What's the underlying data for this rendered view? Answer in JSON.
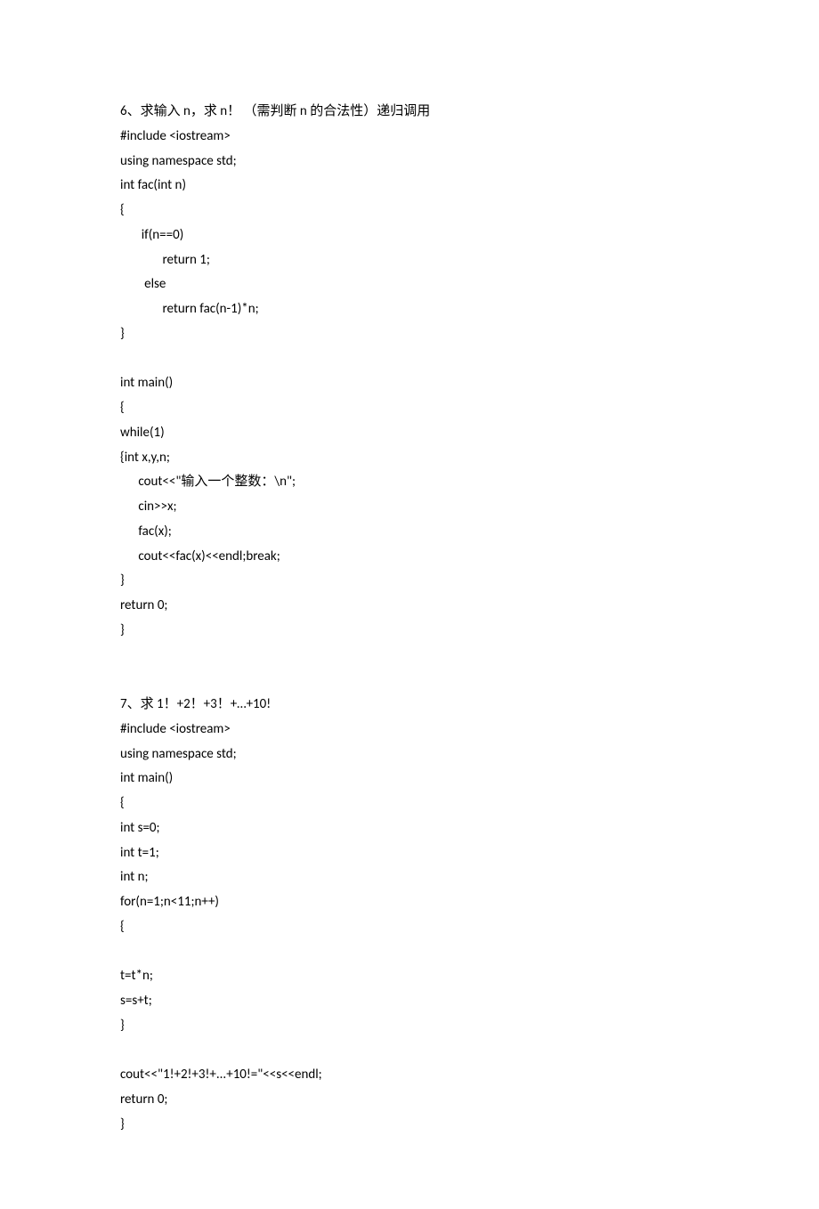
{
  "problem6": {
    "title": "6、求输入 n，求 n！ （需判断 n 的合法性）递归调用",
    "code": [
      "#include <iostream>",
      "using namespace std;",
      "int fac(int n)",
      "{",
      "       if(n==0)",
      "              return 1;",
      "        else",
      "              return fac(n-1)*n;",
      "}",
      "",
      "int main()",
      "{",
      "while(1)",
      "{int x,y,n;",
      "      cout<<\"输入一个整数：\\n\";",
      "      cin>>x;",
      "      fac(x);",
      "      cout<<fac(x)<<endl;break;",
      "}",
      "return 0;",
      "}"
    ]
  },
  "problem7": {
    "title": "7、求 1！+2！+3！+…+10!",
    "code": [
      "#include <iostream>",
      "using namespace std;",
      "int main()",
      "{",
      "int s=0;",
      "int t=1;",
      "int n;",
      "for(n=1;n<11;n++)",
      "{",
      "",
      "t=t*n;",
      "s=s+t;",
      "}",
      "",
      "cout<<\"1!+2!+3!+...+10!=\"<<s<<endl;",
      "return 0;",
      "}"
    ]
  }
}
